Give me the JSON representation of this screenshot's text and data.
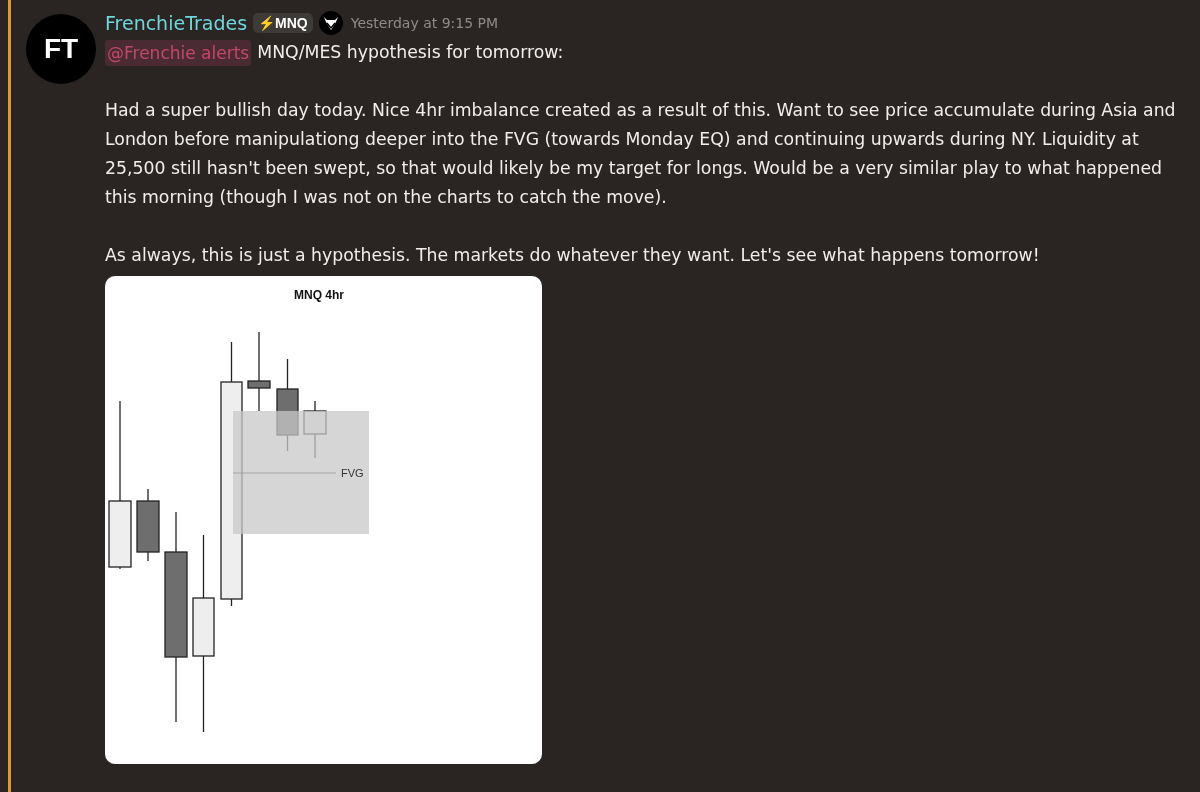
{
  "message": {
    "author": "FrenchieTrades",
    "avatar_initials": "FT",
    "role_tag": {
      "icon": "⚡",
      "label": "MNQ"
    },
    "timestamp": "Yesterday at 9:15 PM",
    "mention": "@Frenchie alerts",
    "first_line": "MNQ/MES hypothesis for tomorrow:",
    "paragraphs": [
      "Had a super bullish day today. Nice 4hr imbalance created as a result of this. Want to see price accumulate during Asia and London before manipulationg deeper into the FVG (towards Monday EQ) and continuing upwards during NY. Liquidity at 25,500 still hasn't been swept, so that would likely be my target for longs. Would be a very similar play to what happened this morning (though I was not on the charts to catch the move).",
      "As always, this is just a hypothesis. The markets do whatever they want. Let's see what happens tomorrow!"
    ],
    "attachment": {
      "title": "MNQ 4hr",
      "zone_label": "FVG"
    }
  }
}
